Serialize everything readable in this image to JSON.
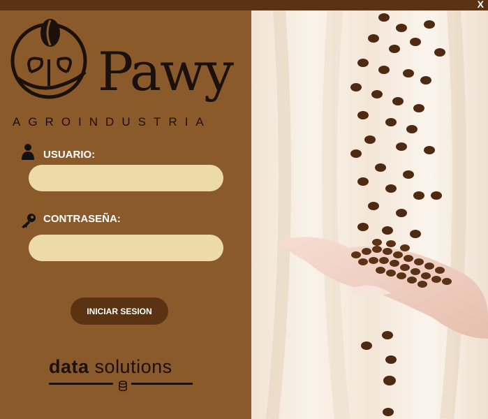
{
  "window": {
    "close_label": "X"
  },
  "brand": {
    "name": "Pawy",
    "subtitle": "AGROINDUSTRIA"
  },
  "form": {
    "user_label": "USUARIO:",
    "user_value": "",
    "password_label": "CONTRASEÑA:",
    "password_value": "",
    "submit_label": "INICIAR SESION"
  },
  "footer": {
    "brand_bold": "data",
    "brand_light": "solutions"
  },
  "colors": {
    "panel": "#8b5a2b",
    "topbar": "#5a3412",
    "input": "#ecdba8",
    "button": "#5a3412"
  },
  "icons": {
    "user": "user-icon",
    "key": "key-icon",
    "close": "close-icon",
    "database": "database-icon"
  }
}
